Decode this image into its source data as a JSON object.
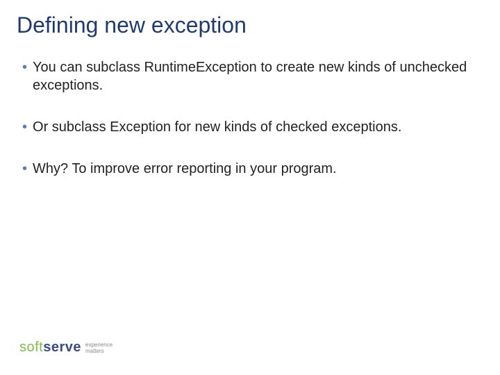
{
  "slide": {
    "title": "Defining new exception",
    "bullets": [
      "You can subclass RuntimeException to create new kinds of unchecked exceptions.",
      "Or subclass Exception for new kinds of checked exceptions.",
      "Why? To improve error reporting in your program."
    ]
  },
  "logo": {
    "part1": "soft",
    "part2": "serve",
    "tagline1": "experience",
    "tagline2": "matters"
  }
}
